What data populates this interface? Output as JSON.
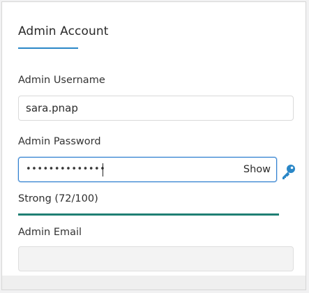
{
  "section": {
    "title": "Admin Account"
  },
  "username": {
    "label": "Admin Username",
    "value": "sara.pnap"
  },
  "password": {
    "label": "Admin Password",
    "masked_value": "••••••••••••••",
    "show_label": "Show",
    "strength_text": "Strong (72/100)",
    "strength_score": 72
  },
  "email": {
    "label": "Admin Email",
    "value": ""
  },
  "colors": {
    "accent": "#2a87c7",
    "strength": "#1f7f74",
    "focus": "#2f7fd0"
  },
  "icons": {
    "generate_password": "key-icon"
  }
}
